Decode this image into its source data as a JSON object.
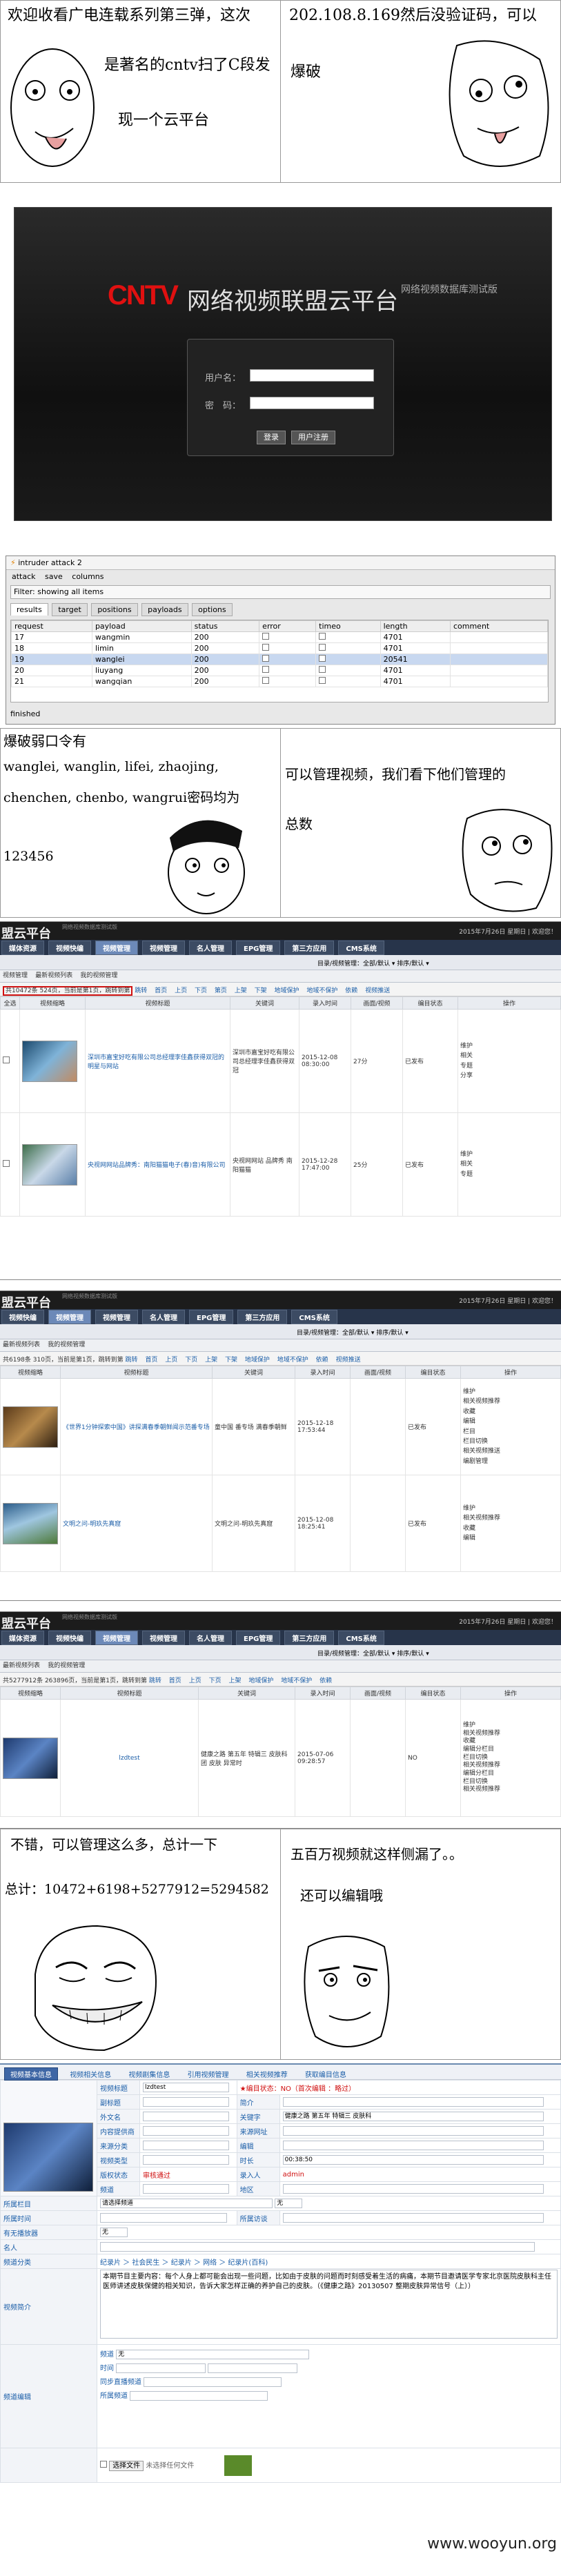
{
  "panel1": {
    "text_left": "欢迎收看广电连载系列第三弹，这次是著名的cntv扫了C段发现一个云平台",
    "line1": "欢迎收看广电连载系列第三弹，这次",
    "line2": "是著名的cntv扫了C段发",
    "line3": "现一个云平台",
    "text_right_1": "202.108.8.169然后没验证码，可以",
    "text_right_2": "爆破"
  },
  "login": {
    "logo_mark": "CNTV",
    "title": "网络视频联盟云平台",
    "subtitle": "网络视频数据库测试版",
    "user_label": "用户名：",
    "pass_label": "密　码：",
    "login_button": "登录",
    "other_button": "用户注册"
  },
  "intruder": {
    "window_title": "intruder attack 2",
    "menu": [
      "attack",
      "save",
      "columns"
    ],
    "filter": "Filter: showing all items",
    "tabs": [
      "results",
      "target",
      "positions",
      "payloads",
      "options"
    ],
    "columns": [
      "request",
      "payload",
      "status",
      "error",
      "timeo",
      "length",
      "comment"
    ],
    "rows": [
      {
        "request": "17",
        "payload": "wangmin",
        "status": "200",
        "length": "4701"
      },
      {
        "request": "18",
        "payload": "limin",
        "status": "200",
        "length": "4701"
      },
      {
        "request": "19",
        "payload": "wanglei",
        "status": "200",
        "length": "20541",
        "selected": true
      },
      {
        "request": "20",
        "payload": "liuyang",
        "status": "200",
        "length": "4701"
      },
      {
        "request": "21",
        "payload": "wangqian",
        "status": "200",
        "length": "4701"
      }
    ],
    "status_text": "finished"
  },
  "panel3": {
    "left_line1": "爆破弱口令有",
    "left_line2": "wanglei, wanglin, lifei, zhaojing,",
    "left_line3": "chenchen, chenbo, wangrui密码均为",
    "left_line4": "123456",
    "right_line1": "可以管理视频，我们看下他们管理的",
    "right_line2": "总数"
  },
  "cms_common": {
    "brand": "盟云平台",
    "brand_sub": "网络视频数据库测试版",
    "date_text": "2015年7月26日 星期日",
    "welcome": "欢迎您！",
    "nav": [
      "媒体资源",
      "视频快编",
      "视频管理",
      "视频管理",
      "名人管理",
      "EPG管理",
      "第三方应用",
      "CMS系统"
    ],
    "filter_text": "目录/视频管理：全部/默认 ▾   排序/默认 ▾",
    "tabs": [
      "视频管理",
      "最新视频列表",
      "我的视频管理"
    ],
    "col_headers": [
      "全选",
      "视频缩略",
      "视频标题",
      "关键词",
      "录入时间",
      "画面/视频",
      "编目状态",
      "操作"
    ]
  },
  "cms1": {
    "pager": "共10472条 524页，当前是第1页，跳转到第",
    "pager_links": [
      "跳转",
      "首页",
      "上页",
      "下页",
      "第页",
      "上架",
      "下架",
      "上架|",
      "地域保护",
      "地域不保护",
      "依赖",
      "视频推送"
    ],
    "rows": [
      {
        "title": "深圳市嘉宝好吃有限公司总经理李佳鑫获得双冠的明星与网站",
        "keywords": "深圳市嘉宝好吃有限公司总经理李佳鑫获得双冠",
        "time": "2015-12-08 08:30:00",
        "dur": "27分",
        "status": "已发布"
      },
      {
        "title": "央视网网站品牌秀：南阳猫猫电子(春)音)有限公司",
        "keywords": "央视网网站 品牌秀 南阳猫猫",
        "time": "2015-12-28 17:47:00",
        "dur": "25分",
        "status": "已发布"
      }
    ],
    "ops": [
      "维护",
      "相关",
      "专题",
      "分享"
    ]
  },
  "cms2": {
    "pager": "共6198条 310页，当前是第1页，跳转到第",
    "rows": [
      {
        "title": "《世界1分钟探索中国》讲探满春季朝鲜闻示范番专场",
        "keywords": "童中国 番专场 满春季朝鲜",
        "time": "2015-12-18 17:53:44",
        "status": "已发布"
      },
      {
        "title": "文明之问-明玖先真窟",
        "keywords": "文明之问-明玖先真窟",
        "time": "2015-12-08 18:25:41",
        "status": "已发布"
      }
    ],
    "ops": [
      "维护",
      "相关视频推荐",
      "收藏",
      "编辑",
      "栏目",
      "栏目切换",
      "相关视频推送",
      "编剧管理"
    ]
  },
  "cms3": {
    "pager": "共5277912条 263896页，当前是第1页，跳转到第",
    "rows": [
      {
        "title": "lzdtest",
        "keywords": "健康之路 第五年 特辑三 皮肤科团 皮肤 异常时",
        "time": "2015-07-06 09:28:57",
        "status": "NO"
      }
    ],
    "ops": [
      "维护",
      "相关视频推荐",
      "收藏",
      "编辑分栏目",
      "栏目切换",
      "相关视频推荐",
      "编辑分栏目",
      "栏目切换",
      "相关视频推荐",
      "编辑分栏目",
      "栏目切换",
      "相关视频推荐"
    ]
  },
  "panel4": {
    "left_line1": "不错，可以管理这么多，总计一下",
    "left_line2": "总计：10472+6198+5277912=5294582",
    "right_line1": "五百万视频就这样侧漏了。。",
    "right_line2": "还可以编辑哦"
  },
  "edit": {
    "tabs": [
      "视频基本信息",
      "视频相关信息",
      "视频剧集信息",
      "引用视频管理",
      "相关视频推荐",
      "获取编目信息"
    ],
    "fields": {
      "title_label": "视频标题",
      "title_value": "lzdtest",
      "subtitle_label": "副标题",
      "short_label": "简介",
      "alias_label": "外文名",
      "keyword_label": "关键字",
      "keyword_value": "健康之路 第五年 特辑三 皮肤科",
      "content_label": "内容提供商",
      "source_label": "来源网址",
      "source_label2": "来源分类",
      "editor_label": "编辑",
      "video_type_label": "视频类型",
      "duration_label": "时长",
      "duration_value": "00:38:50",
      "license_label": "版权状态",
      "license_value": "审核通过",
      "recorder_label": "录入人",
      "recorder_value": "admin",
      "channel_label": "频道",
      "reg_label": "注册",
      "area_label": "地区",
      "column_label": "所属栏目",
      "column_value": "请选择频道",
      "station_label": "所属频道",
      "stationtime_label": "所属时间",
      "visitor_label": "所属访谈",
      "rating_label": "有无播放器",
      "tag_label": "名人",
      "cat_label": "频道分类",
      "cat_path": "纪录片 ＞ 社会民生 ＞ 纪录片 ＞ 网络 ＞ 纪录片(百科)",
      "summary_label": "视频简介",
      "summary_text": "本期节目主要内容：每个人身上都可能会出现一些问题，比如由于皮肤的问题而时刻感受着生活的病痛，本期节目邀请医学专家北京医院皮肤科主任医师讲述皮肤保健的相关知识，告诉大家怎样正确的养护自己的皮肤。（《健康之路》20130507 整期皮肤异常信号（上））",
      "status_hint": "★编目状态：NO（首次编辑 ：略过）",
      "program_label": "频道编辑",
      "channel_opt": "频道",
      "none_opt": "无",
      "upload_label": "选择文件",
      "upload_hint": "未选择任何文件",
      "time_label": "时间",
      "range_label": "同步直播频道"
    }
  },
  "watermark": "www.wooyun.org"
}
